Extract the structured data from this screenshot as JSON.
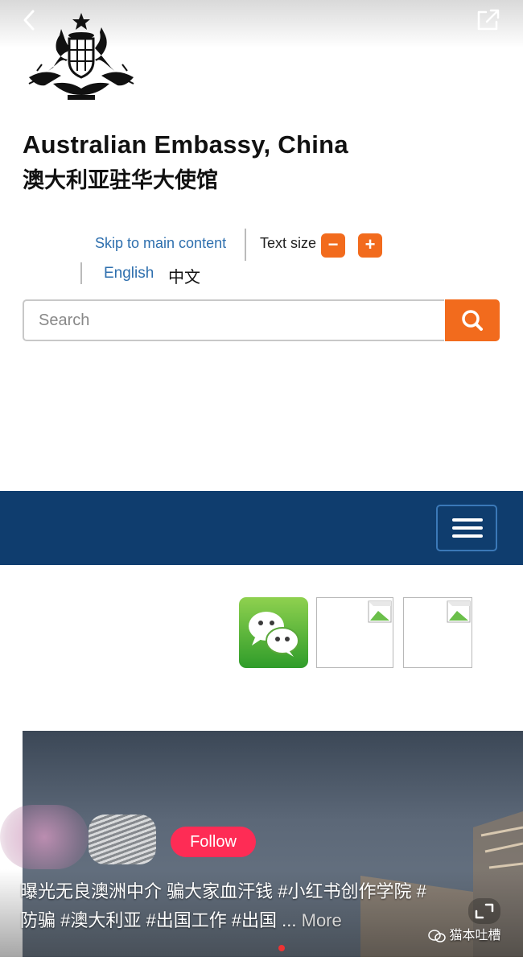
{
  "header": {
    "title_en": "Australian Embassy, China",
    "title_zh": "澳大利亚驻华大使馆"
  },
  "utility": {
    "skip_link": "Skip to main content",
    "text_size_label": "Text size",
    "decrease_label": "−",
    "increase_label": "+",
    "languages": [
      "English",
      "中文"
    ]
  },
  "search": {
    "placeholder": "Search",
    "value": ""
  },
  "icons": [
    "back-icon",
    "share-icon",
    "coat-of-arms",
    "search-icon",
    "hamburger-icon",
    "wechat-icon",
    "broken-image-icon",
    "expand-icon"
  ],
  "colors": {
    "accent": "#f26b1d",
    "nav_bg": "#0f3d6e",
    "link": "#2e6fae",
    "follow": "#fe2c55"
  },
  "overlay": {
    "follow_label": "Follow",
    "caption_main": "曝光无良澳洲中介 骗大家血汗钱 #小红书创作学院 #防骗 #澳大利亚 #出国工作 #出国 ...",
    "caption_more": " More",
    "watermark": "猫本吐槽"
  }
}
